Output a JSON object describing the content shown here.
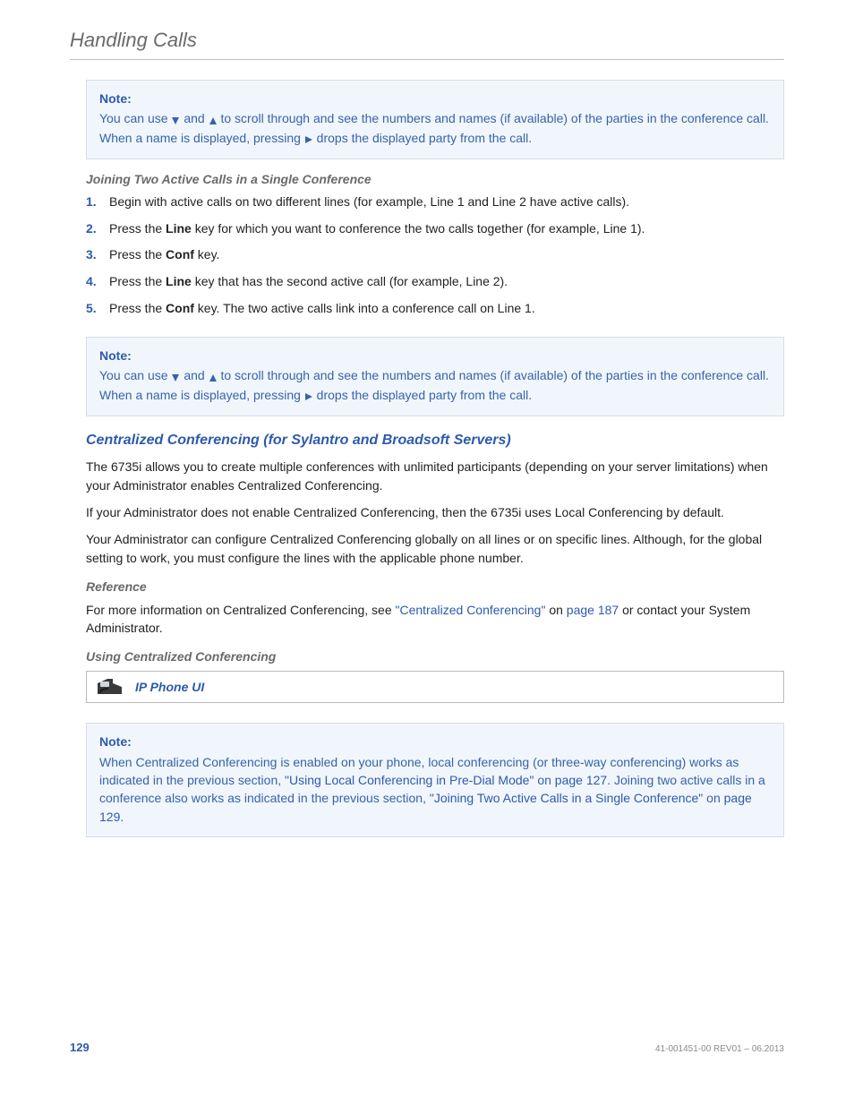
{
  "header": {
    "title": "Handling Calls"
  },
  "note1": {
    "title": "Note:",
    "line_a": "You can use ",
    "line_b": " and ",
    "line_c": " to scroll through and see the numbers and names (if available) of the parties in the conference call. When a name is displayed, pressing ",
    "line_d": " drops the displayed party from the call."
  },
  "joining": {
    "heading": "Joining Two Active Calls in a Single Conference",
    "steps": [
      {
        "num": "1.",
        "text_pre": "Begin with active calls on two different lines (for example, Line 1 and Line 2 have active calls)."
      },
      {
        "num": "2.",
        "text_pre": "Press the ",
        "bold": "Line",
        "text_post": " key for which you want to conference the two calls together (for example, Line 1)."
      },
      {
        "num": "3.",
        "text_pre": "Press the ",
        "bold": "Conf",
        "text_post": " key."
      },
      {
        "num": "4.",
        "text_pre": "Press the ",
        "bold": "Line",
        "text_post": " key that has the second active call (for example, Line 2)."
      },
      {
        "num": "5.",
        "text_pre": "Press the ",
        "bold": "Conf",
        "text_post": " key. The two active calls link into a conference call on Line 1."
      }
    ]
  },
  "note2": {
    "title": "Note:",
    "line_a": "You can use ",
    "line_b": " and ",
    "line_c": " to scroll through and see the numbers and names (if available) of the parties in the conference call. When a name is displayed, pressing ",
    "line_d": " drops the displayed party from the call."
  },
  "centralized": {
    "heading": "Centralized Conferencing (for Sylantro and Broadsoft Servers)",
    "p1": "The 6735i allows you to create multiple conferences with unlimited participants (depending on your server limitations) when your Administrator enables Centralized Conferencing.",
    "p2": "If your Administrator does not enable Centralized Conferencing, then the 6735i uses Local Conferencing by default.",
    "p3": "Your Administrator can configure Centralized Conferencing globally on all lines or on specific lines. Although, for the global setting to work, you must configure the lines with the applicable phone number."
  },
  "reference": {
    "heading": "Reference",
    "text_pre": "For more information on Centralized Conferencing, see ",
    "link1": "\"Centralized Conferencing\"",
    "mid1": " on ",
    "link2": "page 187",
    "text_post": " or contact your System Administrator."
  },
  "using": {
    "heading": "Using Centralized Conferencing",
    "ui_label": "IP Phone UI"
  },
  "note3": {
    "title": "Note:",
    "t1": "When Centralized Conferencing is enabled on your phone, local conferencing (or three-way conferencing) works as indicated in the previous section, ",
    "l1": "\"Using Local Conferencing in Pre-Dial Mode\"",
    "t2": " on ",
    "l2": "page 127",
    "t3": ". Joining two active calls in a conference also works as indicated in the previous section, ",
    "l3": "\"Joining Two Active Calls in a Single Conference\"",
    "t4": " on ",
    "l4": "page 129",
    "t5": "."
  },
  "footer": {
    "page": "129",
    "docid": "41-001451-00 REV01 – 06.2013"
  }
}
